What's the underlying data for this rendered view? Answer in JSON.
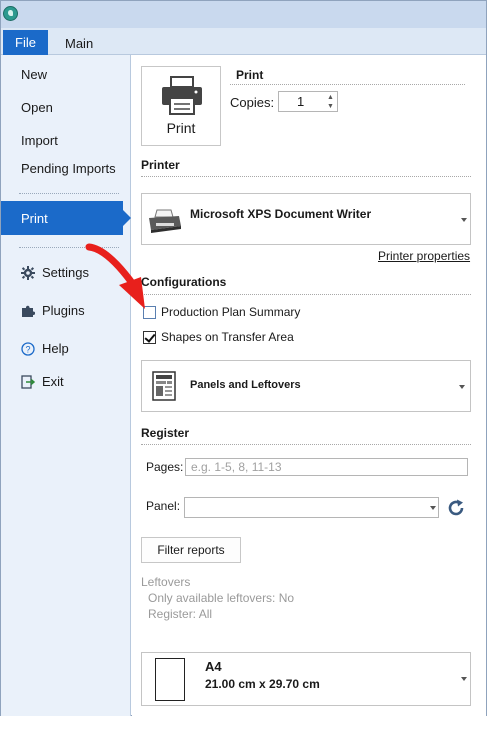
{
  "tabs": {
    "file": "File",
    "main": "Main"
  },
  "sidebar": {
    "new": "New",
    "open": "Open",
    "import": "Import",
    "pending_imports": "Pending Imports",
    "print": "Print",
    "settings": "Settings",
    "plugins": "Plugins",
    "help": "Help",
    "exit": "Exit"
  },
  "print_section": {
    "button_label": "Print",
    "title": "Print",
    "copies_label": "Copies:",
    "copies_value": "1"
  },
  "printer": {
    "title": "Printer",
    "selected": "Microsoft XPS Document Writer",
    "properties_link": "Printer properties"
  },
  "configurations": {
    "title": "Configurations",
    "options": [
      {
        "label": "Production Plan Summary",
        "checked": false
      },
      {
        "label": "Shapes on Transfer Area",
        "checked": true
      }
    ],
    "report_type": "Panels and Leftovers"
  },
  "register": {
    "title": "Register",
    "pages_label": "Pages:",
    "pages_placeholder": "e.g. 1-5, 8, 11-13",
    "panel_label": "Panel:",
    "panel_value": "",
    "filter_button": "Filter reports",
    "leftovers_heading": "Leftovers",
    "leftovers_line1": "Only available leftovers: No",
    "leftovers_line2": "Register: All"
  },
  "paper": {
    "name": "A4",
    "size": "21.00 cm x 29.70 cm"
  },
  "colors": {
    "accent": "#1b6ac9",
    "sidebar_bg": "#eaf1fa",
    "annotation_arrow": "#e8201c"
  }
}
